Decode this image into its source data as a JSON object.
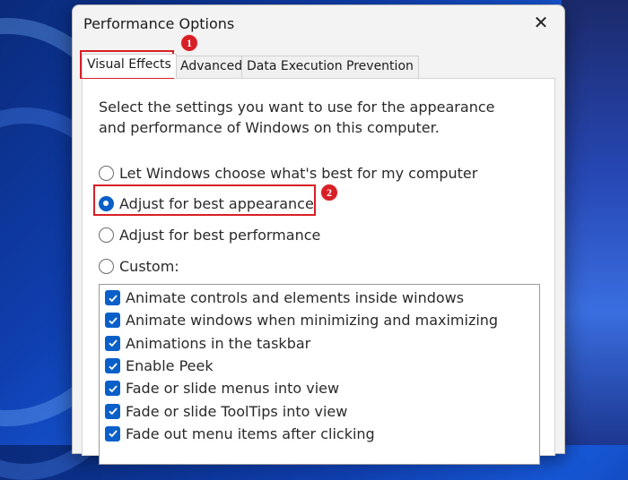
{
  "window": {
    "title": "Performance Options",
    "close_glyph": "✕"
  },
  "tabs": [
    {
      "label": "Visual Effects",
      "active": true
    },
    {
      "label": "Advanced",
      "active": false
    },
    {
      "label": "Data Execution Prevention",
      "active": false
    }
  ],
  "panel": {
    "description": "Select the settings you want to use for the appearance and performance of Windows on this computer.",
    "options": [
      {
        "label": "Let Windows choose what's best for my computer",
        "checked": false
      },
      {
        "label": "Adjust for best appearance",
        "checked": true
      },
      {
        "label": "Adjust for best performance",
        "checked": false
      },
      {
        "label": "Custom:",
        "checked": false
      }
    ],
    "effects": [
      {
        "label": "Animate controls and elements inside windows",
        "checked": true
      },
      {
        "label": "Animate windows when minimizing and maximizing",
        "checked": true
      },
      {
        "label": "Animations in the taskbar",
        "checked": true
      },
      {
        "label": "Enable Peek",
        "checked": true
      },
      {
        "label": "Fade or slide menus into view",
        "checked": true
      },
      {
        "label": "Fade or slide ToolTips into view",
        "checked": true
      },
      {
        "label": "Fade out menu items after clicking",
        "checked": true
      }
    ]
  },
  "annotations": {
    "badge_1": "1",
    "badge_2": "2",
    "color": "#d81f26"
  },
  "colors": {
    "accent": "#0a5fc8"
  }
}
